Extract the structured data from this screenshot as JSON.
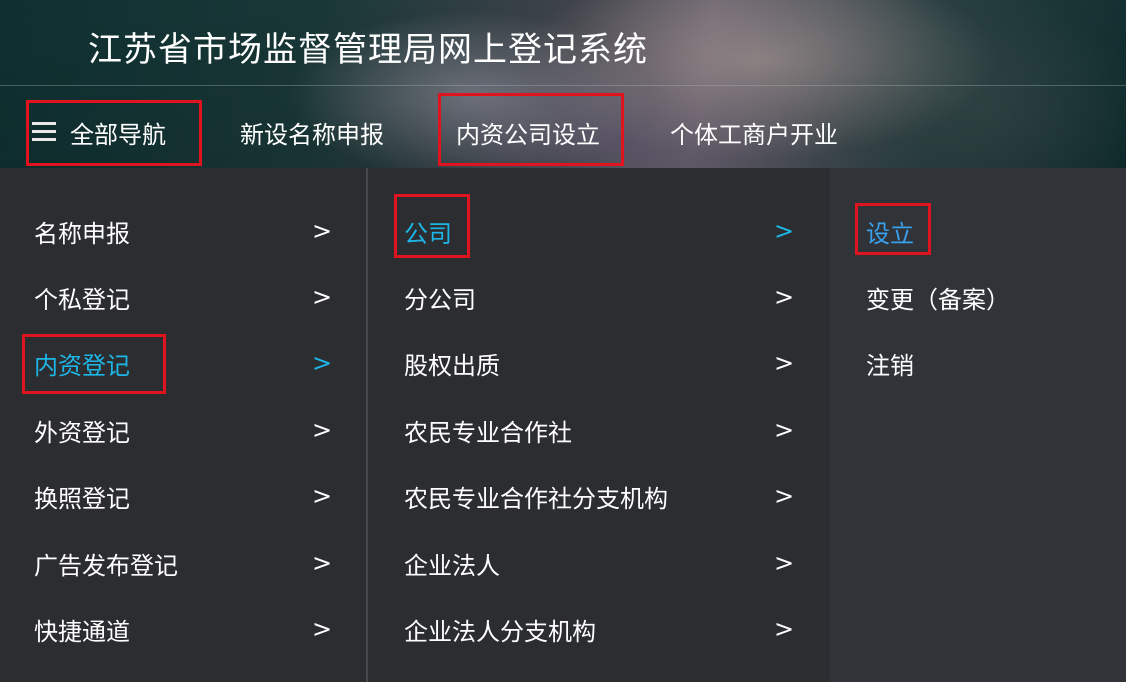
{
  "header": {
    "title": "江苏省市场监督管理局网上登记系统"
  },
  "nav": {
    "all_nav": "全部导航",
    "items": [
      "新设名称申报",
      "内资公司设立",
      "个体工商户开业"
    ]
  },
  "menu": {
    "level1": [
      {
        "label": "名称申报",
        "arrow": ">"
      },
      {
        "label": "个私登记",
        "arrow": ">"
      },
      {
        "label": "内资登记",
        "arrow": ">",
        "active": true
      },
      {
        "label": "外资登记",
        "arrow": ">"
      },
      {
        "label": "换照登记",
        "arrow": ">"
      },
      {
        "label": "广告发布登记",
        "arrow": ">"
      },
      {
        "label": "快捷通道",
        "arrow": ">"
      }
    ],
    "level2": [
      {
        "label": "公司",
        "arrow": ">",
        "active": true
      },
      {
        "label": "分公司",
        "arrow": ">"
      },
      {
        "label": "股权出质",
        "arrow": ">"
      },
      {
        "label": "农民专业合作社",
        "arrow": ">"
      },
      {
        "label": "农民专业合作社分支机构",
        "arrow": ">"
      },
      {
        "label": "企业法人",
        "arrow": ">"
      },
      {
        "label": "企业法人分支机构",
        "arrow": ">"
      }
    ],
    "level3": [
      {
        "label": "设立",
        "active": true
      },
      {
        "label": "变更（备案）"
      },
      {
        "label": "注销"
      }
    ]
  },
  "colors": {
    "highlight_box": "#e0141e",
    "active_text": "#1eb6e6",
    "active_text_level3": "#3aa1ee",
    "menu_bg": "#2b2d31"
  }
}
